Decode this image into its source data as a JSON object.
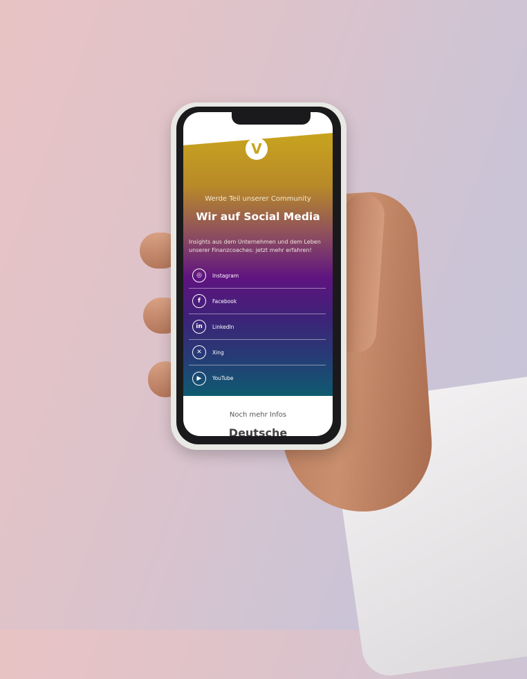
{
  "screen": {
    "subtitle": "Werde Teil unserer Community",
    "title": "Wir auf Social Media",
    "description": "Insights aus dem Unternehmen und dem Leben unserer Finanzcoaches: jetzt mehr erfahren!",
    "social": [
      {
        "label": "Instagram",
        "icon": "instagram-icon",
        "glyph": "◎"
      },
      {
        "label": "Facebook",
        "icon": "facebook-icon",
        "glyph": "f"
      },
      {
        "label": "LinkedIn",
        "icon": "linkedin-icon",
        "glyph": "in"
      },
      {
        "label": "Xing",
        "icon": "xing-icon",
        "glyph": "✕"
      },
      {
        "label": "YouTube",
        "icon": "youtube-icon",
        "glyph": "▶"
      }
    ],
    "more_heading": "Noch mehr Infos",
    "next_heading": "Deutsche",
    "logo_letter": "V",
    "colors": {
      "gold": "#c8a41e",
      "purple": "#5f1480",
      "teal": "#0e5a70"
    }
  }
}
